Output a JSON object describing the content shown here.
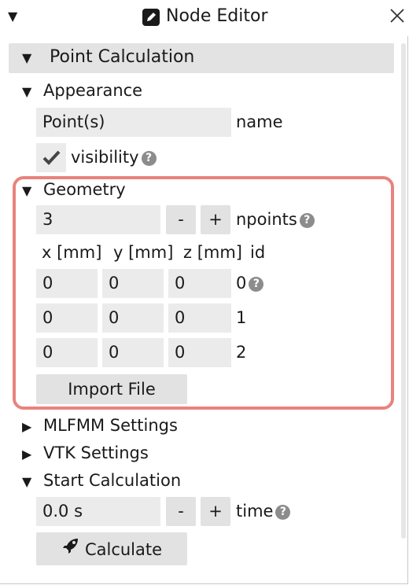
{
  "window": {
    "title": "Node Editor",
    "collapse_icon": "triangle-down-icon",
    "edit_icon": "pencil-icon",
    "close_icon": "close-icon"
  },
  "section": {
    "title": "Point Calculation",
    "appearance": {
      "title": "Appearance",
      "name_value": "Point(s)",
      "name_label": "name",
      "visibility_label": "visibility",
      "visibility_checked": true
    },
    "geometry": {
      "title": "Geometry",
      "npoints_value": "3",
      "minus_label": "-",
      "plus_label": "+",
      "npoints_label": "npoints",
      "columns": [
        "x [mm]",
        "y [mm]",
        "z [mm]",
        "id"
      ],
      "rows": [
        {
          "x": "0",
          "y": "0",
          "z": "0",
          "id": "0"
        },
        {
          "x": "0",
          "y": "0",
          "z": "0",
          "id": "1"
        },
        {
          "x": "0",
          "y": "0",
          "z": "0",
          "id": "2"
        }
      ],
      "import_label": "Import File",
      "highlight_color": "#e8837d"
    },
    "mlfmm": {
      "title": "MLFMM Settings"
    },
    "vtk": {
      "title": "VTK Settings"
    },
    "start": {
      "title": "Start Calculation",
      "time_value": "0.0 s",
      "minus_label": "-",
      "plus_label": "+",
      "time_label": "time",
      "calculate_label": "Calculate",
      "calculate_icon": "rocket-icon"
    }
  },
  "help_glyph": "?",
  "colors": {
    "field_bg": "#ebebeb",
    "button_bg": "#e2e2e2",
    "header_bg": "#e3e3e3",
    "help_bg": "#8c8c8c"
  }
}
